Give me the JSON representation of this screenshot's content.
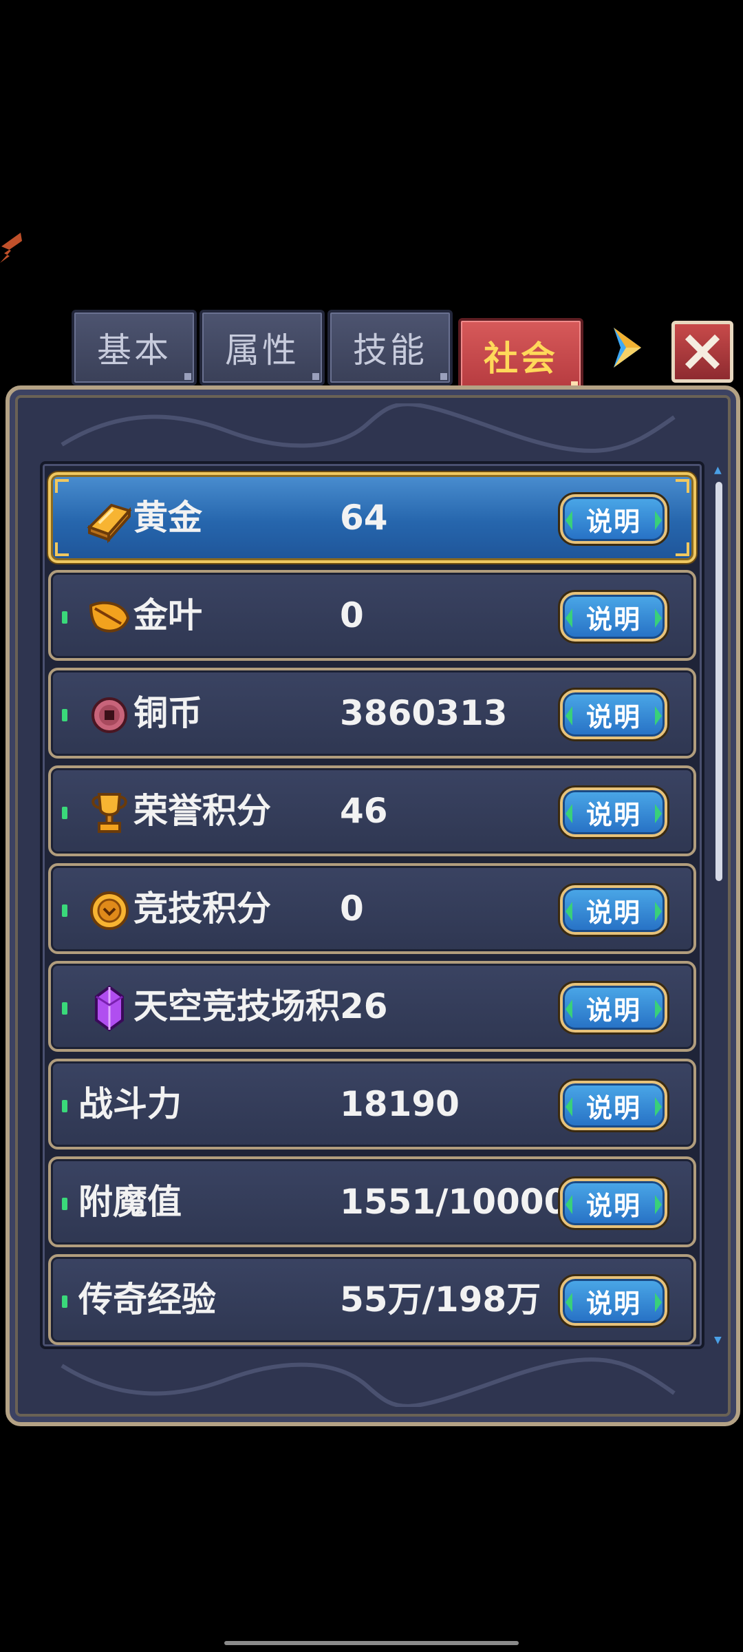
{
  "tabs": [
    {
      "label": "基本",
      "active": false
    },
    {
      "label": "属性",
      "active": false
    },
    {
      "label": "技能",
      "active": false
    },
    {
      "label": "社会",
      "active": true
    }
  ],
  "icons": {
    "back": "back-arrow-icon",
    "next": "next-arrow-icon",
    "close": "close-icon"
  },
  "rows": [
    {
      "label": "黄金",
      "value": "64",
      "icon": "gold-bar-icon",
      "button": "说明",
      "selected": true
    },
    {
      "label": "金叶",
      "value": "0",
      "icon": "gold-leaf-icon",
      "button": "说明"
    },
    {
      "label": "铜币",
      "value": "3860313",
      "icon": "copper-coin-icon",
      "button": "说明"
    },
    {
      "label": "荣誉积分",
      "value": "46",
      "icon": "trophy-icon",
      "button": "说明"
    },
    {
      "label": "竞技积分",
      "value": "0",
      "icon": "arena-medal-icon",
      "button": "说明"
    },
    {
      "label": "天空竞技场积分",
      "value": "26",
      "icon": "purple-crystal-icon",
      "button": "说明"
    },
    {
      "label": "战斗力",
      "value": "18190",
      "button": "说明"
    },
    {
      "label": "附魔值",
      "value": "1551/10000",
      "button": "说明"
    },
    {
      "label": "传奇经验",
      "value": "55万/198万",
      "button": "说明"
    }
  ],
  "colors": {
    "selected_row": "#2666ad",
    "selected_border": "#f0c860",
    "active_tab": "#b53a3f",
    "active_tab_text": "#ffd95a",
    "button_blue": "#2670c4"
  }
}
